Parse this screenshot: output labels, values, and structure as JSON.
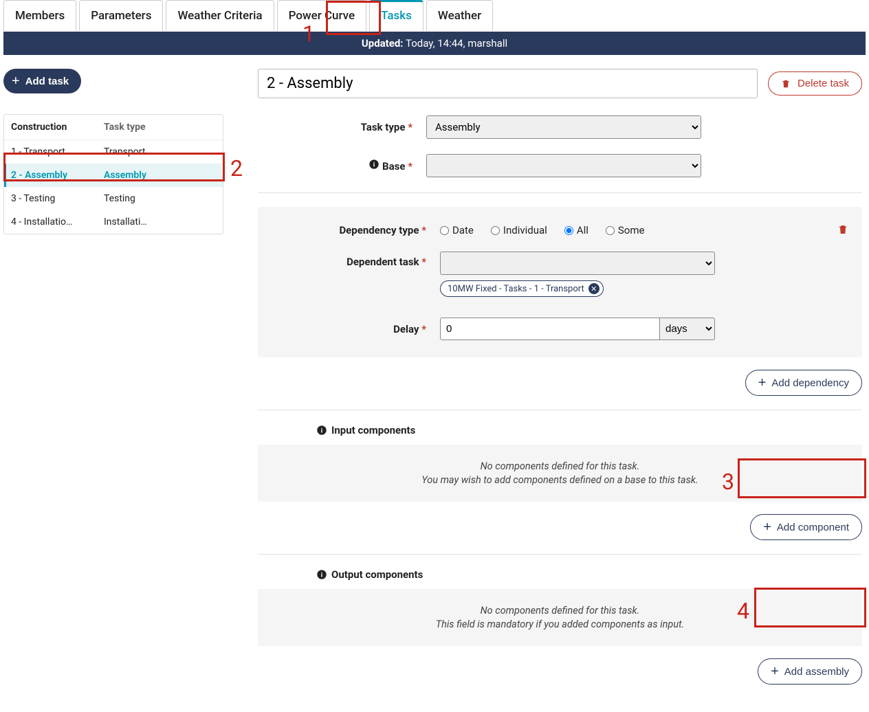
{
  "tabs": [
    "Members",
    "Parameters",
    "Weather Criteria",
    "Power Curve",
    "Tasks",
    "Weather"
  ],
  "active_tab": "Tasks",
  "updated": {
    "label": "Updated:",
    "value": "Today, 14:44, marshall"
  },
  "sidebar": {
    "add_task_label": "Add task",
    "head": {
      "col1": "Construction",
      "col2": "Task type"
    },
    "rows": [
      {
        "name": "1 - Transport",
        "type": "Transport",
        "selected": false
      },
      {
        "name": "2 - Assembly",
        "type": "Assembly",
        "selected": true
      },
      {
        "name": "3 - Testing",
        "type": "Testing",
        "selected": false
      },
      {
        "name": "4 - Installatio…",
        "type": "Installati…",
        "selected": false
      }
    ]
  },
  "title_value": "2 - Assembly",
  "delete_task_label": "Delete task",
  "form": {
    "task_type_label": "Task type",
    "task_type_value": "Assembly",
    "base_label": "Base"
  },
  "dependency": {
    "type_label": "Dependency type",
    "options": [
      "Date",
      "Individual",
      "All",
      "Some"
    ],
    "selected_option": "All",
    "task_label": "Dependent task",
    "chip_text": "10MW Fixed - Tasks - 1 - Transport",
    "delay_label": "Delay",
    "delay_value": "0",
    "delay_unit": "days"
  },
  "add_dependency_label": "Add dependency",
  "input_components": {
    "heading": "Input components",
    "empty1": "No components defined for this task.",
    "empty2": "You may wish to add components defined on a base to this task.",
    "button": "Add component"
  },
  "output_components": {
    "heading": "Output components",
    "empty1": "No components defined for this task.",
    "empty2": "This field is mandatory if you added components as input.",
    "button": "Add assembly"
  },
  "annotations": [
    "1",
    "2",
    "3",
    "4"
  ]
}
